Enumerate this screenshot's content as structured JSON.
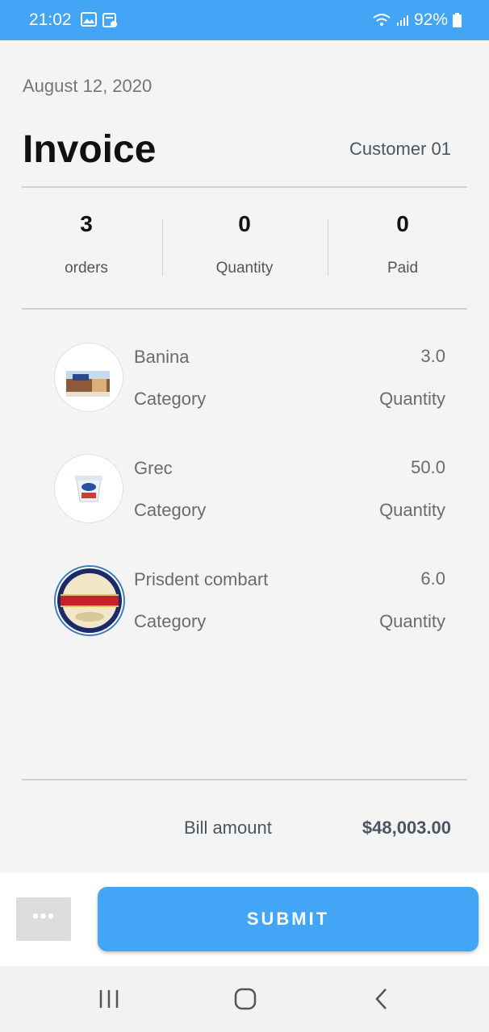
{
  "status_bar": {
    "time": "21:02",
    "battery": "92%"
  },
  "header": {
    "date": "August 12, 2020",
    "title": "Invoice",
    "customer": "Customer 01"
  },
  "stats": [
    {
      "value": "3",
      "label": "orders"
    },
    {
      "value": "0",
      "label": "Quantity"
    },
    {
      "value": "0",
      "label": "Paid"
    }
  ],
  "items": [
    {
      "name": "Banina",
      "category": "Category",
      "value": "3.0",
      "quantity_label": "Quantity",
      "image": "dessert-box-thumbnail"
    },
    {
      "name": "Grec",
      "category": "Category",
      "value": "50.0",
      "quantity_label": "Quantity",
      "image": "yogurt-cup-thumbnail"
    },
    {
      "name": "Prisdent combart",
      "category": "Category",
      "value": "6.0",
      "quantity_label": "Quantity",
      "image": "camembert-box-thumbnail"
    }
  ],
  "bill": {
    "label": "Bill amount",
    "amount": "$48,003.00"
  },
  "actions": {
    "more_label": "•••",
    "submit_label": "SUBMIT"
  },
  "colors": {
    "accent": "#42a5f5",
    "background": "#f4f4f4"
  }
}
